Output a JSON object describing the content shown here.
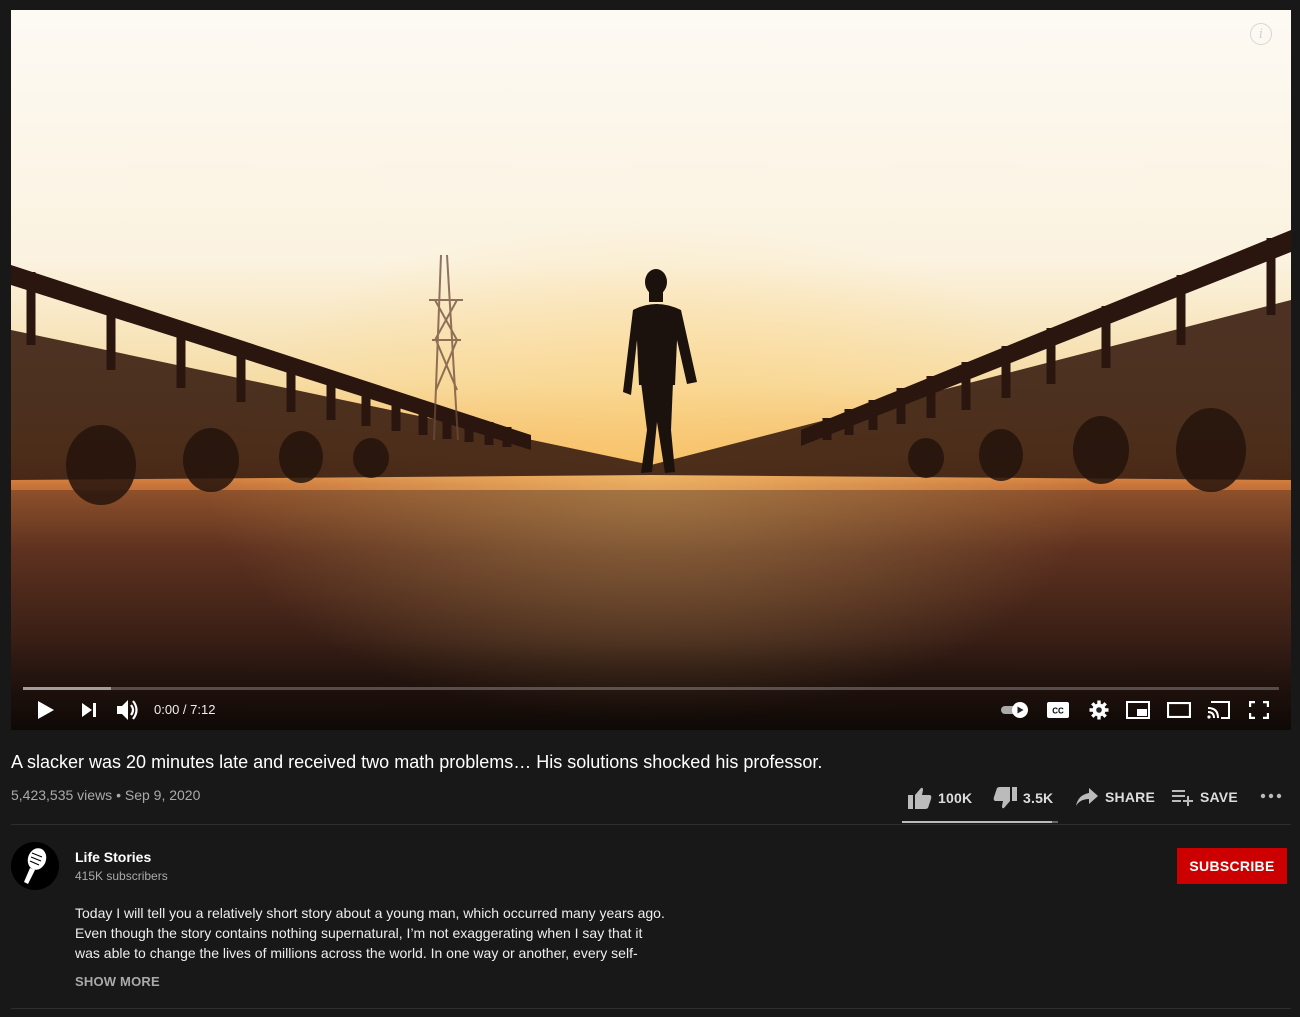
{
  "player": {
    "time_current": "0:00",
    "time_total": "7:12",
    "time_display": "0:00 / 7:12",
    "buffered_fraction": 0.07,
    "autoplay_on": true
  },
  "video": {
    "title": "A slacker was 20 minutes late and received two math problems… His solutions shocked his professor.",
    "views": "5,423,535 views",
    "date": "Sep 9, 2020",
    "meta_line": "5,423,535 views • Sep 9, 2020"
  },
  "actions": {
    "like_count": "100K",
    "dislike_count": "3.5K",
    "share_label": "SHARE",
    "save_label": "SAVE",
    "like_fraction": 0.96
  },
  "channel": {
    "name": "Life Stories",
    "subscribers": "415K subscribers",
    "subscribe_label": "SUBSCRIBE"
  },
  "description": {
    "lines": [
      "Today I will tell you a relatively short story about a young man, which occurred many years ago.",
      "Even though the story contains nothing supernatural, I’m not exaggerating when I say that it",
      "was able to change the lives of millions across the world. In one way or another, every self-"
    ],
    "show_more_label": "SHOW MORE"
  },
  "icons": {
    "play": "play-icon",
    "next": "next-icon",
    "volume": "volume-icon",
    "autoplay": "autoplay-toggle-icon",
    "captions": "captions-icon",
    "settings": "gear-icon",
    "miniplayer": "miniplayer-icon",
    "theater": "theater-mode-icon",
    "cast": "cast-icon",
    "fullscreen": "fullscreen-icon",
    "like": "thumbs-up-icon",
    "dislike": "thumbs-down-icon",
    "share": "share-arrow-icon",
    "save": "playlist-add-icon",
    "more": "more-horizontal-icon",
    "info": "info-icon"
  },
  "colors": {
    "background": "#181818",
    "subscribe": "#cc0000",
    "secondary_text": "#aaaaaa"
  }
}
